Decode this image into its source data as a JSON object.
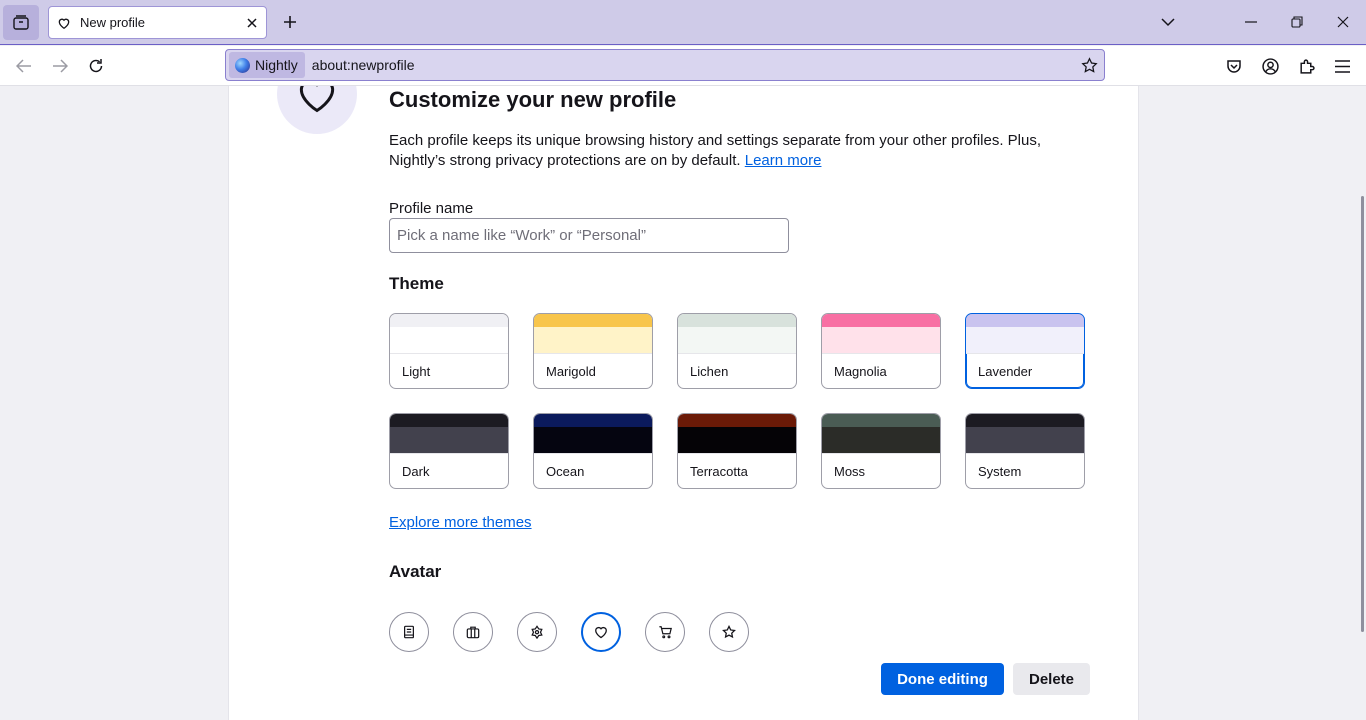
{
  "tab": {
    "title": "New profile",
    "close_label": "×"
  },
  "urlbar": {
    "identity_label": "Nightly",
    "url": "about:newprofile"
  },
  "page": {
    "title": "Customize your new profile",
    "description": "Each profile keeps its unique browsing history and settings separate from your other profiles. Plus, Nightly’s strong privacy protections are on by default.",
    "learn_more": "Learn more",
    "profile_name_label": "Profile name",
    "profile_name_value": "",
    "profile_name_placeholder": "Pick a name like “Work” or “Personal”",
    "theme_heading": "Theme",
    "themes": [
      {
        "name": "Light",
        "top": "#f0f0f4",
        "mid": "#ffffff",
        "selected": false
      },
      {
        "name": "Marigold",
        "top": "#f8c54b",
        "mid": "#fff3c8",
        "selected": false
      },
      {
        "name": "Lichen",
        "top": "#d8e2dc",
        "mid": "#f3f7f4",
        "selected": false
      },
      {
        "name": "Magnolia",
        "top": "#f86fa3",
        "mid": "#ffe1ea",
        "selected": false
      },
      {
        "name": "Lavender",
        "top": "#c9c3ef",
        "mid": "#f1f0fb",
        "selected": true
      },
      {
        "name": "Dark",
        "top": "#1c1b22",
        "mid": "#42414d",
        "selected": false
      },
      {
        "name": "Ocean",
        "top": "#0b1a5c",
        "mid": "#050510",
        "selected": false
      },
      {
        "name": "Terracotta",
        "top": "#6b1a07",
        "mid": "#050306",
        "selected": false
      },
      {
        "name": "Moss",
        "top": "#4a5c54",
        "mid": "#2b2c28",
        "selected": false
      },
      {
        "name": "System",
        "top": "#1c1b22",
        "mid": "#42414d",
        "selected": false
      }
    ],
    "explore_themes": "Explore more themes",
    "avatar_heading": "Avatar",
    "avatars": [
      {
        "icon": "book-icon",
        "selected": false
      },
      {
        "icon": "briefcase-icon",
        "selected": false
      },
      {
        "icon": "flower-icon",
        "selected": false
      },
      {
        "icon": "heart-icon",
        "selected": true
      },
      {
        "icon": "shopping-cart-icon",
        "selected": false
      },
      {
        "icon": "star-icon",
        "selected": false
      }
    ],
    "done_button": "Done editing",
    "delete_button": "Delete"
  },
  "colors": {
    "accent": "#0061e0",
    "tabstrip": "#cfcbe8",
    "urlbar": "#d9d5ef"
  }
}
